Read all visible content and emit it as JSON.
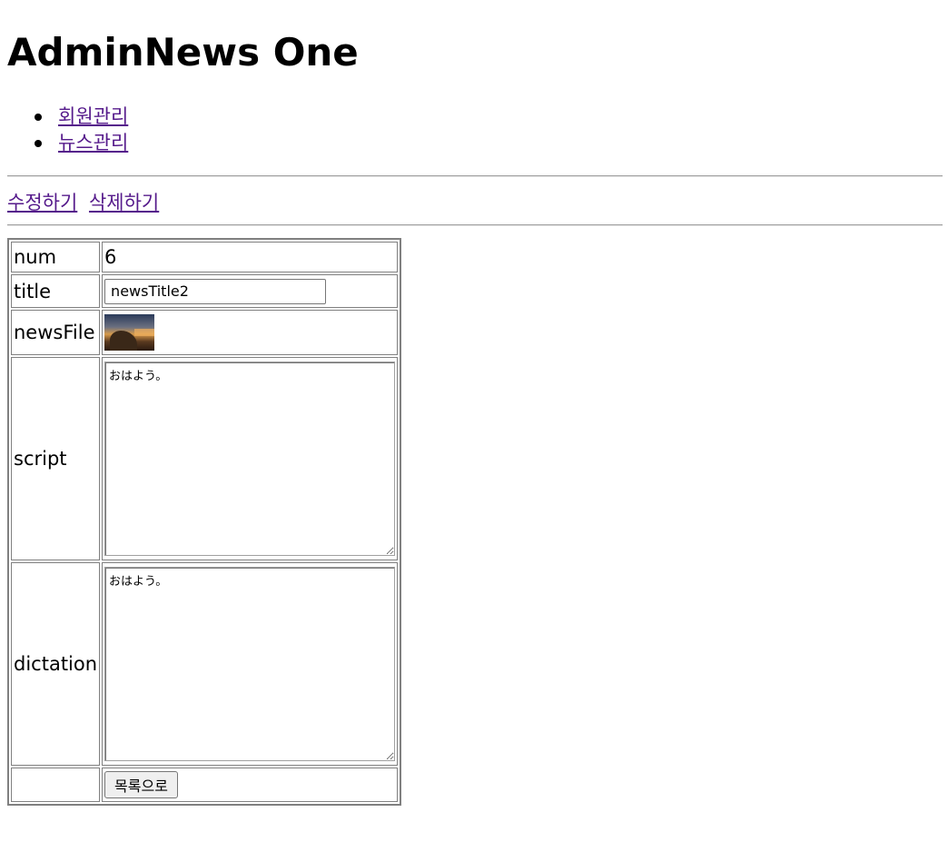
{
  "header": {
    "title": "AdminNews One"
  },
  "nav": {
    "items": [
      {
        "label": "회원관리"
      },
      {
        "label": "뉴스관리"
      }
    ]
  },
  "actions": {
    "edit_label": "수정하기",
    "delete_label": "삭제하기"
  },
  "detail": {
    "num_label": "num",
    "num_value": "6",
    "title_label": "title",
    "title_value": "newsTitle2",
    "file_label": "newsFile",
    "script_label": "script",
    "script_value": "おはよう。",
    "dictation_label": "dictation",
    "dictation_value": "おはよう。",
    "back_button_label": "목록으로"
  },
  "colors": {
    "link_visited": "#551a8b",
    "border": "#808080"
  }
}
